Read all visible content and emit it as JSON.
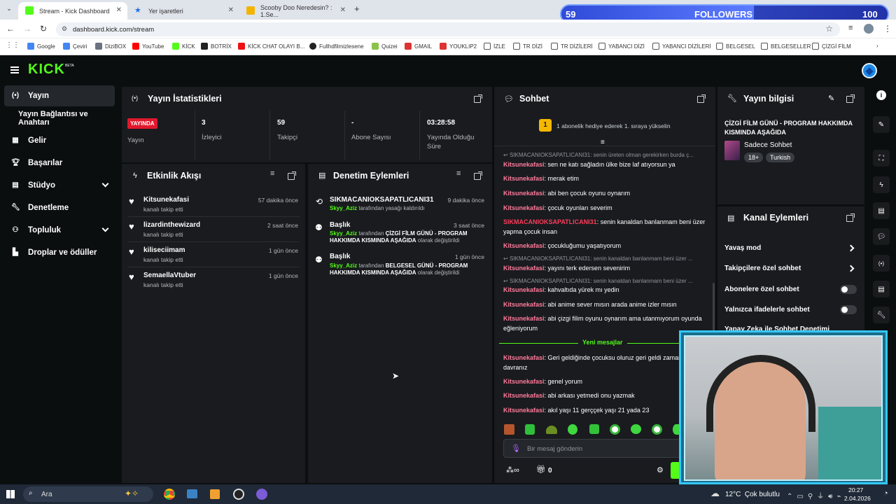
{
  "browser": {
    "tabs": [
      {
        "title": "Stream - Kick Dashboard"
      },
      {
        "title": "Yer işaretleri"
      },
      {
        "title": "Scooby Doo Neredesin? : 1.Se..."
      }
    ],
    "url": "dashboard.kick.com/stream",
    "bookmarks": [
      "Google",
      "Çeviri",
      "DiziBOX",
      "YouTube",
      "KİCK",
      "BOTRİX",
      "KİCK CHAT OLAYI B...",
      "Fullhdfilmizlesene",
      "Quizei",
      "GMAIL",
      "YOUKLIP2",
      "İZLE",
      "TR DİZİ",
      "TR DİZİLERİ",
      "YABANCI DİZİ",
      "YABANCI DİZİLERİ",
      "BELGESEL",
      "BELGESELLER",
      "ÇİZGİ FİLM"
    ]
  },
  "overlay": {
    "followers_count": "59",
    "followers_label": "FOLLOWERS",
    "goal": "100"
  },
  "kick": {
    "logo": "KICK",
    "beta": "BETA"
  },
  "sidebar": {
    "items": [
      {
        "label": "Yayın"
      },
      {
        "label": "Yayın Bağlantısı ve Anahtarı"
      },
      {
        "label": "Gelir"
      },
      {
        "label": "Başarılar"
      },
      {
        "label": "Stüdyo"
      },
      {
        "label": "Denetleme"
      },
      {
        "label": "Topluluk"
      },
      {
        "label": "Droplar ve ödüller"
      }
    ]
  },
  "stats": {
    "title": "Yayın İstatistikleri",
    "live_badge": "YAYINDA",
    "live_label": "Yayın",
    "viewers": "3",
    "viewers_label": "İzleyici",
    "followers": "59",
    "followers_label": "Takipçi",
    "subs": "-",
    "subs_label": "Abone Sayısı",
    "uptime": "03:28:58",
    "uptime_label": "Yayında Olduğu Süre"
  },
  "activity": {
    "title": "Etkinlik Akışı",
    "items": [
      {
        "name": "Kitsunekafasi",
        "action": "kanalı takip etti",
        "time": "57 dakika önce"
      },
      {
        "name": "lizardinthewizard",
        "action": "kanalı takip etti",
        "time": "2 saat önce"
      },
      {
        "name": "kiliseciimam",
        "action": "kanalı takip etti",
        "time": "1 gün önce"
      },
      {
        "name": "SemaellaVtuber",
        "action": "kanalı takip etti",
        "time": "1 gün önce"
      }
    ]
  },
  "moderation": {
    "title": "Denetim Eylemleri",
    "items": [
      {
        "name": "SIKMACANIOKSAPATLICANI31",
        "user": "Skyy_Aziz",
        "text": " tarafından yasağı kaldırıldı",
        "detail": "",
        "tail": "",
        "time": "9 dakika önce"
      },
      {
        "name": "Başlık",
        "user": "Skyy_Aziz",
        "text": " tarafından ",
        "detail": "ÇİZGİ FİLM GÜNÜ - PROGRAM HAKKIMDA KISMINDA AŞAĞIDA",
        "tail": " olarak değiştirildi",
        "time": "3 saat önce"
      },
      {
        "name": "Başlık",
        "user": "Skyy_Aziz",
        "text": " tarafından ",
        "detail": "BELGESEL GÜNÜ - PROGRAM HAKKIMDA KISMINDA AŞAĞIDA",
        "tail": " olarak değiştirildi",
        "time": "1 gün önce"
      }
    ]
  },
  "chat": {
    "title": "Sohbet",
    "gift_rank": "1",
    "gift_text": "1 abonelik hediye ederek 1. sıraya yükselin",
    "new_messages": "Yeni mesajlar",
    "placeholder": "Bir mesaj gönderin",
    "points": "0",
    "messages": [
      {
        "reply": "SIKMACANIOKSAPATLICANI31: senin üreten olman gerekirken burda ç...",
        "user": "Kitsunekafasi",
        "text": ": sen ne katı sağladın ülke bize laf atıyorsun ya"
      },
      {
        "reply": "",
        "user": "Kitsunekafasi",
        "text": ": merak etim"
      },
      {
        "reply": "",
        "user": "Kitsunekafasi",
        "text": ": abi ben çocuk oyunu oynarım"
      },
      {
        "reply": "",
        "user": "Kitsunekafasi",
        "text": ": çocuk oyunları severim"
      },
      {
        "reply": "",
        "user": "SIKMACANIOKSAPATLICANI31",
        "text": ": senin kanaldan banlanmam beni üzer yapma çocuk insan"
      },
      {
        "reply": "",
        "user": "Kitsunekafasi",
        "text": ": çocukluğumu yaşatıyorum"
      },
      {
        "reply": "SIKMACANIOKSAPATLICANI31: senin kanaldan banlanmam beni üzer ...",
        "user": "Kitsunekafasi",
        "text": ": yayını terk edersen sevenirim"
      },
      {
        "reply": "SIKMACANIOKSAPATLICANI31: senin kanaldan banlanmam beni üzer ...",
        "user": "Kitsunekafasi",
        "text": ": kahvaltıda yürek mı yedin"
      },
      {
        "reply": "",
        "user": "Kitsunekafasi",
        "text": ": abi anime sever mısın arada anime izler mısın"
      },
      {
        "reply": "",
        "user": "Kitsunekafasi",
        "text": ": abi çizgi filim oyunu oynarım ama utanmıyorum oyunda eğleniyorum"
      },
      {
        "reply": "",
        "user": "Kitsunekafasi",
        "text": ": Geri geldiğinde çocuksu oluruz geri geldi zaman davranız"
      },
      {
        "reply": "",
        "user": "Kitsunekafasi",
        "text": ": genel yorum"
      },
      {
        "reply": "",
        "user": "Kitsunekafasi",
        "text": ": abi arkası yetmedi onu yazmak"
      },
      {
        "reply": "",
        "user": "Kitsunekafasi",
        "text": ": akıl yaşı 11 gerççek yaşı 21 yada 23"
      }
    ]
  },
  "stream_info": {
    "title": "Yayın bilgisi",
    "stream_title": "ÇİZGİ FİLM GÜNÜ - PROGRAM HAKKIMDA KISMINDA AŞAĞIDA",
    "category": "Sadece Sohbet",
    "tags": [
      "18+",
      "Turkish"
    ]
  },
  "channel_actions": {
    "title": "Kanal Eylemleri",
    "items": [
      {
        "label": "Yavaş mod"
      },
      {
        "label": "Takipçilere özel sohbet"
      },
      {
        "label": "Abonelere özel sohbet"
      },
      {
        "label": "Yalnızca ifadelerle sohbet"
      },
      {
        "label": "Yapay Zeka ile Sohbet Denetimi"
      }
    ]
  },
  "taskbar": {
    "search": "Ara",
    "weather": "12°C  Çok bulutlu",
    "time": "20:27",
    "date": "2.04.2026"
  },
  "colors": {
    "kick_green": "#53fc18",
    "live_red": "#e0182d",
    "panel": "#191b1f",
    "bg": "#0b0e0f"
  }
}
